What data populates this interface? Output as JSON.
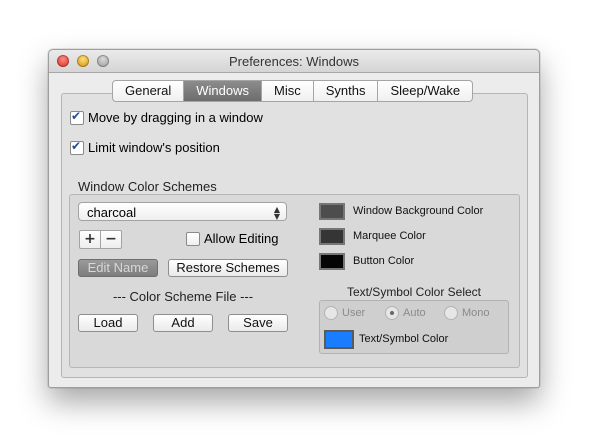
{
  "window": {
    "title": "Preferences: Windows"
  },
  "tabs": [
    "General",
    "Windows",
    "Misc",
    "Synths",
    "Sleep/Wake"
  ],
  "active_tab": "Windows",
  "options": {
    "move_by_dragging": {
      "label": "Move by dragging in a window",
      "checked": true
    },
    "limit_position": {
      "label": "Limit window's position",
      "checked": true
    }
  },
  "schemes": {
    "heading": "Window Color Schemes",
    "selected": "charcoal",
    "add_symbol": "+",
    "remove_symbol": "−",
    "allow_editing": {
      "label": "Allow Editing",
      "checked": false
    },
    "edit_name": "Edit Name",
    "restore": "Restore Schemes",
    "file_heading": "--- Color Scheme File ---",
    "load": "Load",
    "add": "Add",
    "save": "Save"
  },
  "colors": {
    "background": {
      "label": "Window Background Color",
      "hex": "#4d4d4d"
    },
    "marquee": {
      "label": "Marquee Color",
      "hex": "#353535"
    },
    "button": {
      "label": "Button Color",
      "hex": "#050505"
    }
  },
  "text_symbol": {
    "heading": "Text/Symbol Color Select",
    "options": [
      "User",
      "Auto",
      "Mono"
    ],
    "selected": "Auto",
    "color_label": "Text/Symbol Color",
    "color_hex": "#1a7cff"
  }
}
